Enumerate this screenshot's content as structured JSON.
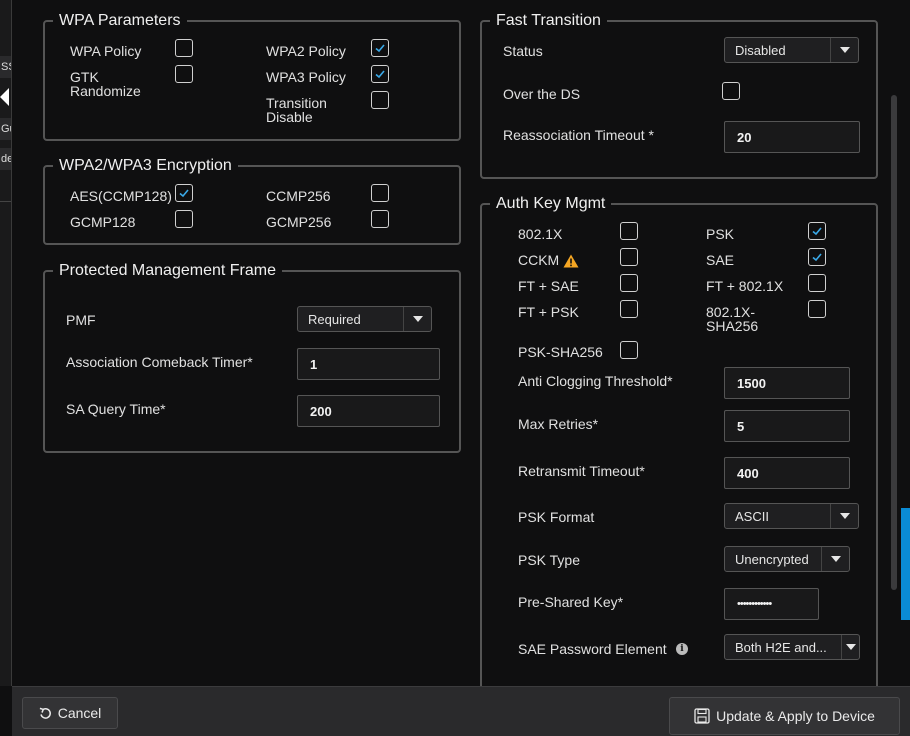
{
  "left_strip": {
    "frag1": "SS",
    "frag2": "Gu",
    "frag3": "de"
  },
  "wpa_parameters": {
    "legend": "WPA Parameters",
    "wpa_policy": "WPA Policy",
    "wpa2_policy": "WPA2 Policy",
    "gtk_randomize_l1": "GTK",
    "gtk_randomize_l2": "Randomize",
    "wpa3_policy": "WPA3 Policy",
    "transition_disable_l1": "Transition",
    "transition_disable_l2": "Disable"
  },
  "encryption": {
    "legend": "WPA2/WPA3 Encryption",
    "aes": "AES(CCMP128)",
    "ccmp256": "CCMP256",
    "gcmp128": "GCMP128",
    "gcmp256": "GCMP256"
  },
  "pmf": {
    "legend": "Protected Management Frame",
    "pmf_label": "PMF",
    "pmf_value": "Required",
    "comeback_label": "Association Comeback Timer*",
    "comeback_value": "1",
    "sa_query_label": "SA Query Time*",
    "sa_query_value": "200"
  },
  "fast_transition": {
    "legend": "Fast Transition",
    "status_label": "Status",
    "status_value": "Disabled",
    "over_ds_label": "Over the DS",
    "reassoc_label": "Reassociation Timeout *",
    "reassoc_value": "20"
  },
  "akm": {
    "legend": "Auth Key Mgmt",
    "dot1x": "802.1X",
    "psk": "PSK",
    "cckm": "CCKM",
    "sae": "SAE",
    "ft_sae": "FT + SAE",
    "ft_dot1x": "FT + 802.1X",
    "ft_psk": "FT + PSK",
    "dot1x_sha256_l1": "802.1X-",
    "dot1x_sha256_l2": "SHA256",
    "psk_sha256": "PSK-SHA256",
    "anti_clog_label": "Anti Clogging Threshold*",
    "anti_clog_value": "1500",
    "max_retries_label": "Max Retries*",
    "max_retries_value": "5",
    "retransmit_label": "Retransmit Timeout*",
    "retransmit_value": "400",
    "psk_format_label": "PSK Format",
    "psk_format_value": "ASCII",
    "psk_type_label": "PSK Type",
    "psk_type_value": "Unencrypted",
    "psk_key_label": "Pre-Shared Key*",
    "psk_key_value": "••••••••••••",
    "sae_pwe_label": "SAE Password Element",
    "sae_pwe_value": "Both H2E and..."
  },
  "footer": {
    "cancel": "Cancel",
    "apply": "Update & Apply to Device"
  },
  "colors": {
    "accent": "#0a8bd4",
    "warning": "#f5a623"
  }
}
